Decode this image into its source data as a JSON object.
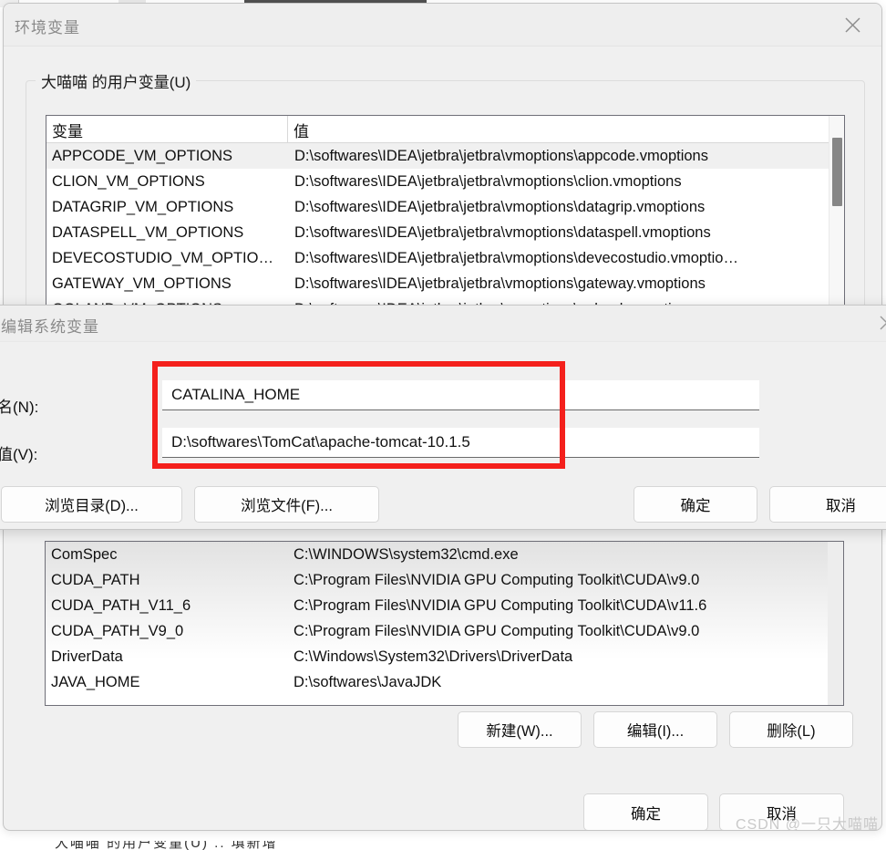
{
  "background": {
    "bottom_ghost_text": "大喵喵 的用户变量(U)  ..  填新增"
  },
  "env_dialog": {
    "title": "环境变量",
    "close_icon": "close-icon",
    "user_group": {
      "legend": "大喵喵 的用户变量(U)",
      "columns": [
        "变量",
        "值"
      ],
      "rows": [
        {
          "name": "APPCODE_VM_OPTIONS",
          "value": "D:\\softwares\\IDEA\\jetbra\\jetbra\\vmoptions\\appcode.vmoptions"
        },
        {
          "name": "CLION_VM_OPTIONS",
          "value": "D:\\softwares\\IDEA\\jetbra\\jetbra\\vmoptions\\clion.vmoptions"
        },
        {
          "name": "DATAGRIP_VM_OPTIONS",
          "value": "D:\\softwares\\IDEA\\jetbra\\jetbra\\vmoptions\\datagrip.vmoptions"
        },
        {
          "name": "DATASPELL_VM_OPTIONS",
          "value": "D:\\softwares\\IDEA\\jetbra\\jetbra\\vmoptions\\dataspell.vmoptions"
        },
        {
          "name": "DEVECOSTUDIO_VM_OPTIO…",
          "value": "D:\\softwares\\IDEA\\jetbra\\jetbra\\vmoptions\\devecostudio.vmoptio…"
        },
        {
          "name": "GATEWAY_VM_OPTIONS",
          "value": "D:\\softwares\\IDEA\\jetbra\\jetbra\\vmoptions\\gateway.vmoptions"
        },
        {
          "name": "GOLAND_VM_OPTIONS",
          "value": "D:\\softwares\\IDEA\\jetbra\\jetbra\\vmoptions\\goland.vmoptions"
        }
      ]
    },
    "sys_group": {
      "rows": [
        {
          "name": "ComSpec",
          "value": "C:\\WINDOWS\\system32\\cmd.exe"
        },
        {
          "name": "CUDA_PATH",
          "value": "C:\\Program Files\\NVIDIA GPU Computing Toolkit\\CUDA\\v9.0"
        },
        {
          "name": "CUDA_PATH_V11_6",
          "value": "C:\\Program Files\\NVIDIA GPU Computing Toolkit\\CUDA\\v11.6"
        },
        {
          "name": "CUDA_PATH_V9_0",
          "value": "C:\\Program Files\\NVIDIA GPU Computing Toolkit\\CUDA\\v9.0"
        },
        {
          "name": "DriverData",
          "value": "C:\\Windows\\System32\\Drivers\\DriverData"
        },
        {
          "name": "JAVA_HOME",
          "value": "D:\\softwares\\JavaJDK"
        }
      ],
      "buttons": {
        "new": "新建(W)...",
        "edit": "编辑(I)...",
        "delete": "删除(L)"
      }
    },
    "footer": {
      "ok": "确定",
      "cancel": "取消"
    }
  },
  "edit_dialog": {
    "title": "编辑系统变量",
    "close_icon": "close-icon",
    "name_label": "变量名(N):",
    "name_value": "CATALINA_HOME",
    "value_label": "变量值(V):",
    "value_value": "D:\\softwares\\TomCat\\apache-tomcat-10.1.5",
    "buttons": {
      "browse_dir": "浏览目录(D)...",
      "browse_file": "浏览文件(F)...",
      "ok": "确定",
      "cancel": "取消"
    }
  },
  "annotation": {
    "highlight_color": "#f4201c"
  },
  "watermark": {
    "text": "CSDN @一只大喵喵"
  }
}
